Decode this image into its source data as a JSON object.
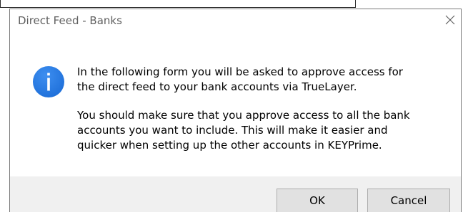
{
  "dialog": {
    "title": "Direct Feed - Banks",
    "close_icon": "close-icon",
    "message_icon": "info-icon",
    "message_paragraph_1": "In the following form you will be asked to approve access for\nthe direct feed to your bank accounts via TrueLayer.",
    "message_paragraph_2": "You should make sure that you approve access to all the bank\naccounts you want to include. This will make it easier and\nquicker when setting up the other accounts in KEYPrime.",
    "buttons": {
      "ok_label": "OK",
      "cancel_label": "Cancel"
    }
  },
  "colors": {
    "info_icon_blue": "#1e6fd9",
    "footer_background": "#f0f0f0",
    "button_face": "#e1e1e1"
  }
}
